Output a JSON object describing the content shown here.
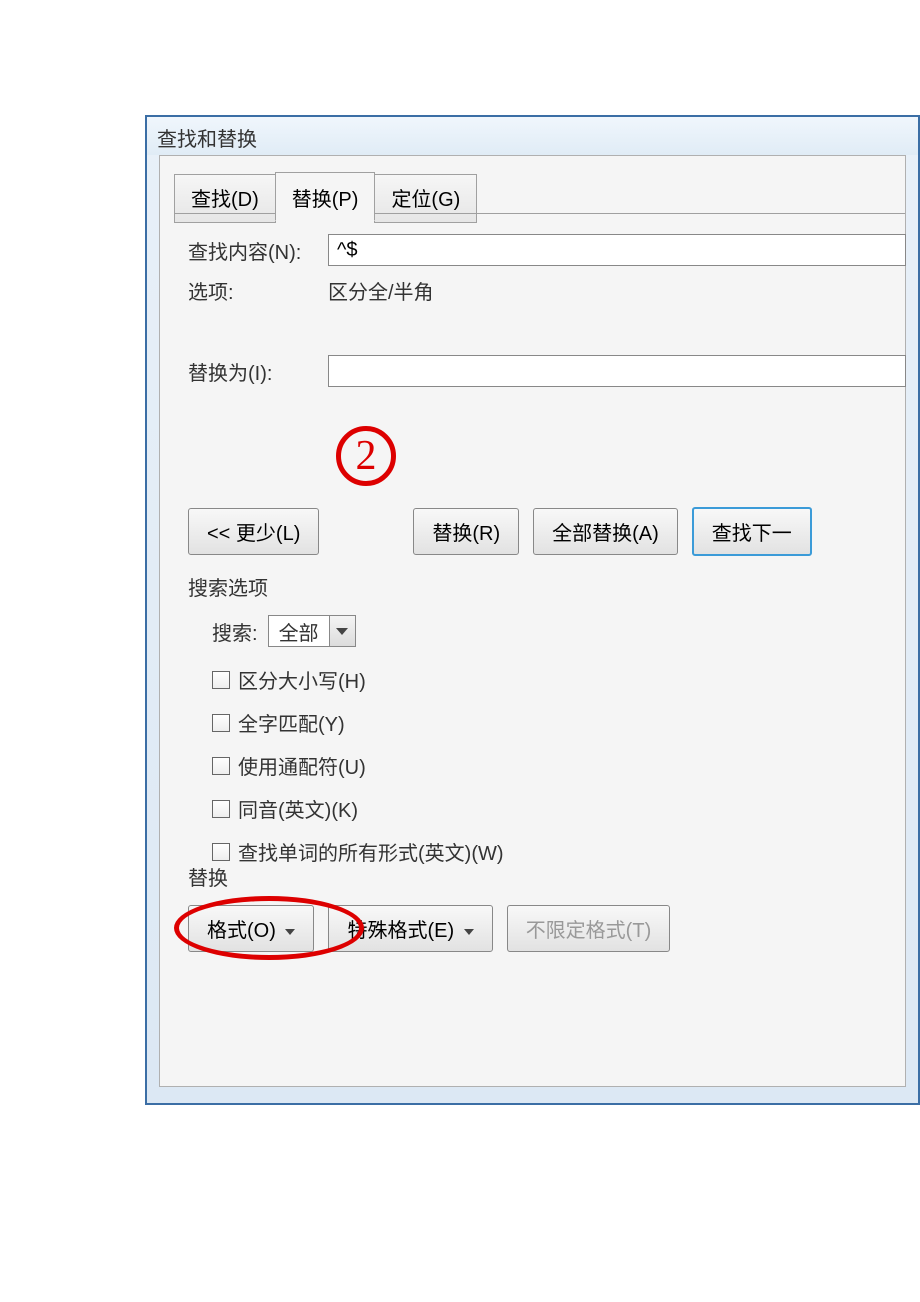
{
  "dialog": {
    "title": "查找和替换",
    "tabs": {
      "find": "查找(D)",
      "replace": "替换(P)",
      "goto": "定位(G)"
    },
    "findLabel": "查找内容(N):",
    "findValue": "^$",
    "optionsLabel": "选项:",
    "optionsValue": "区分全/半角",
    "replaceLabel": "替换为(I):",
    "replaceValue": "",
    "buttons": {
      "less": "<< 更少(L)",
      "replace": "替换(R)",
      "replaceAll": "全部替换(A)",
      "findNext": "查找下一"
    },
    "searchOptions": {
      "heading": "搜索选项",
      "searchLabel": "搜索:",
      "searchValue": "全部",
      "matchCase": "区分大小写(H)",
      "wholeWord": "全字匹配(Y)",
      "wildcards": "使用通配符(U)",
      "soundsLike": "同音(英文)(K)",
      "wordForms": "查找单词的所有形式(英文)(W)"
    },
    "replaceSection": {
      "heading": "替换",
      "format": "格式(O)",
      "special": "特殊格式(E)",
      "noFormat": "不限定格式(T)"
    }
  },
  "annotations": {
    "step2": "2"
  }
}
